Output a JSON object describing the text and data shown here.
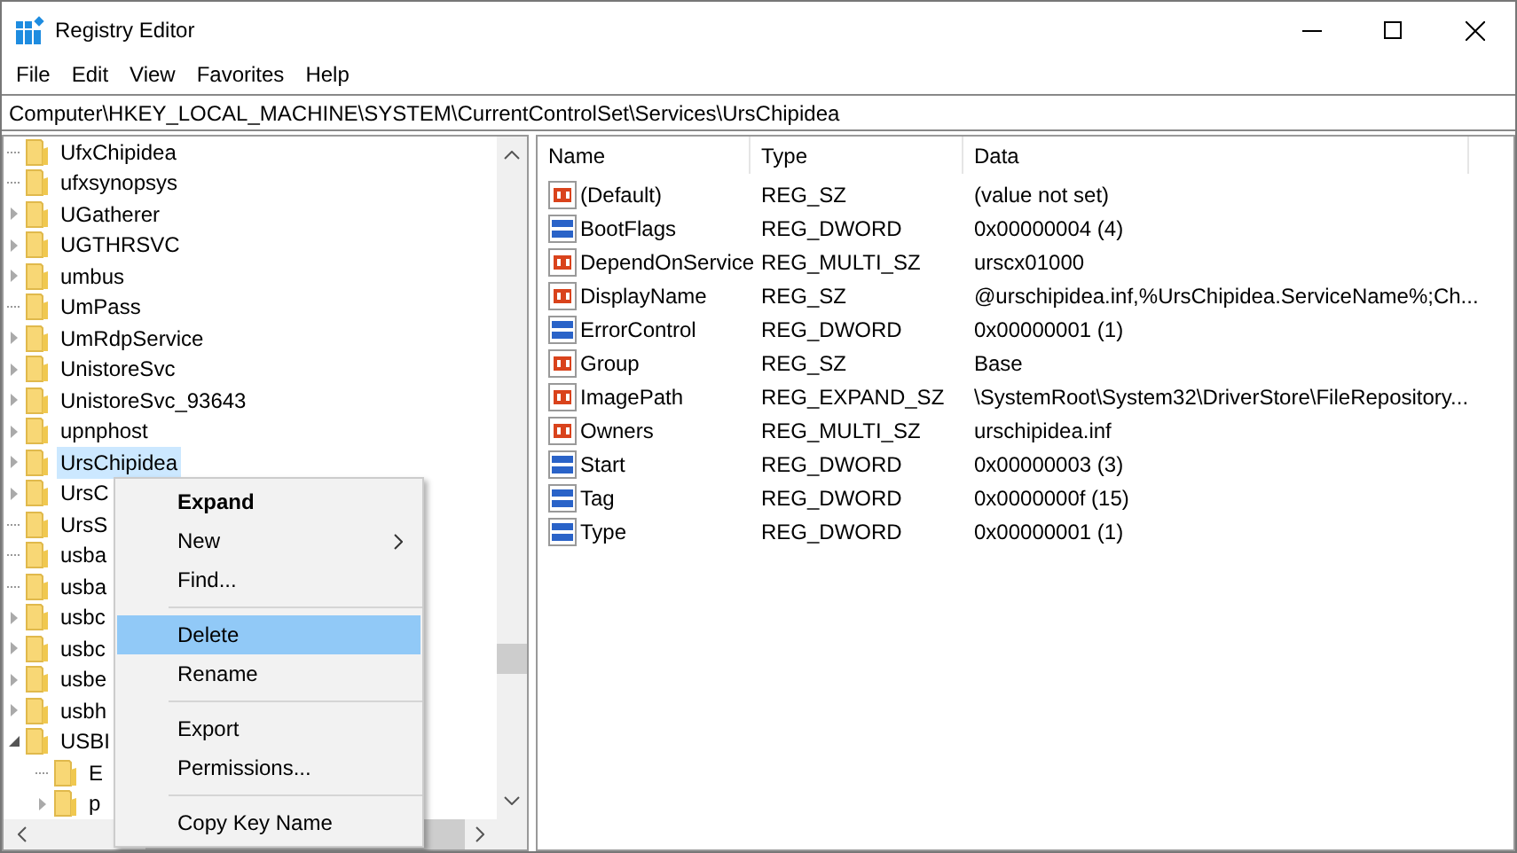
{
  "window": {
    "title": "Registry Editor"
  },
  "menu_bar": [
    "File",
    "Edit",
    "View",
    "Favorites",
    "Help"
  ],
  "address_bar": {
    "value": "Computer\\HKEY_LOCAL_MACHINE\\SYSTEM\\CurrentControlSet\\Services\\UrsChipidea"
  },
  "tree": [
    {
      "label": "UfxChipidea",
      "expandable": false,
      "selected": false
    },
    {
      "label": "ufxsynopsys",
      "expandable": false,
      "selected": false
    },
    {
      "label": "UGatherer",
      "expandable": true,
      "selected": false
    },
    {
      "label": "UGTHRSVC",
      "expandable": true,
      "selected": false
    },
    {
      "label": "umbus",
      "expandable": true,
      "selected": false
    },
    {
      "label": "UmPass",
      "expandable": false,
      "selected": false
    },
    {
      "label": "UmRdpService",
      "expandable": true,
      "selected": false
    },
    {
      "label": "UnistoreSvc",
      "expandable": true,
      "selected": false
    },
    {
      "label": "UnistoreSvc_93643",
      "expandable": true,
      "selected": false
    },
    {
      "label": "upnphost",
      "expandable": true,
      "selected": false
    },
    {
      "label": "UrsChipidea",
      "expandable": true,
      "selected": true
    },
    {
      "label": "UrsC",
      "expandable": true,
      "selected": false
    },
    {
      "label": "UrsS",
      "expandable": false,
      "selected": false
    },
    {
      "label": "usba",
      "expandable": false,
      "selected": false
    },
    {
      "label": "usba",
      "expandable": false,
      "selected": false
    },
    {
      "label": "usbc",
      "expandable": true,
      "selected": false
    },
    {
      "label": "usbc",
      "expandable": true,
      "selected": false
    },
    {
      "label": "usbe",
      "expandable": true,
      "selected": false
    },
    {
      "label": "usbh",
      "expandable": true,
      "selected": false
    },
    {
      "label": "USBI",
      "expandable": true,
      "expanded": true,
      "selected": false,
      "children": [
        {
          "label": "E",
          "expandable": false,
          "selected": false
        },
        {
          "label": "p",
          "expandable": true,
          "selected": false
        }
      ]
    }
  ],
  "table": {
    "columns": [
      "Name",
      "Type",
      "Data"
    ],
    "rows": [
      {
        "kind": "string",
        "name": "(Default)",
        "type": "REG_SZ",
        "data": "(value not set)"
      },
      {
        "kind": "binary",
        "name": "BootFlags",
        "type": "REG_DWORD",
        "data": "0x00000004 (4)"
      },
      {
        "kind": "string",
        "name": "DependOnService",
        "type": "REG_MULTI_SZ",
        "data": "urscx01000"
      },
      {
        "kind": "string",
        "name": "DisplayName",
        "type": "REG_SZ",
        "data": "@urschipidea.inf,%UrsChipidea.ServiceName%;Ch..."
      },
      {
        "kind": "binary",
        "name": "ErrorControl",
        "type": "REG_DWORD",
        "data": "0x00000001 (1)"
      },
      {
        "kind": "string",
        "name": "Group",
        "type": "REG_SZ",
        "data": "Base"
      },
      {
        "kind": "string",
        "name": "ImagePath",
        "type": "REG_EXPAND_SZ",
        "data": "\\SystemRoot\\System32\\DriverStore\\FileRepository..."
      },
      {
        "kind": "string",
        "name": "Owners",
        "type": "REG_MULTI_SZ",
        "data": "urschipidea.inf"
      },
      {
        "kind": "binary",
        "name": "Start",
        "type": "REG_DWORD",
        "data": "0x00000003 (3)"
      },
      {
        "kind": "binary",
        "name": "Tag",
        "type": "REG_DWORD",
        "data": "0x0000000f (15)"
      },
      {
        "kind": "binary",
        "name": "Type",
        "type": "REG_DWORD",
        "data": "0x00000001 (1)"
      }
    ]
  },
  "context_menu": [
    {
      "kind": "item",
      "label": "Expand",
      "bold": true,
      "submenu": false,
      "selected": false
    },
    {
      "kind": "item",
      "label": "New",
      "bold": false,
      "submenu": true,
      "selected": false
    },
    {
      "kind": "item",
      "label": "Find...",
      "bold": false,
      "submenu": false,
      "selected": false
    },
    {
      "kind": "separator"
    },
    {
      "kind": "item",
      "label": "Delete",
      "bold": false,
      "submenu": false,
      "selected": true
    },
    {
      "kind": "item",
      "label": "Rename",
      "bold": false,
      "submenu": false,
      "selected": false
    },
    {
      "kind": "separator"
    },
    {
      "kind": "item",
      "label": "Export",
      "bold": false,
      "submenu": false,
      "selected": false
    },
    {
      "kind": "item",
      "label": "Permissions...",
      "bold": false,
      "submenu": false,
      "selected": false
    },
    {
      "kind": "separator"
    },
    {
      "kind": "item",
      "label": "Copy Key Name",
      "bold": false,
      "submenu": false,
      "selected": false
    }
  ]
}
